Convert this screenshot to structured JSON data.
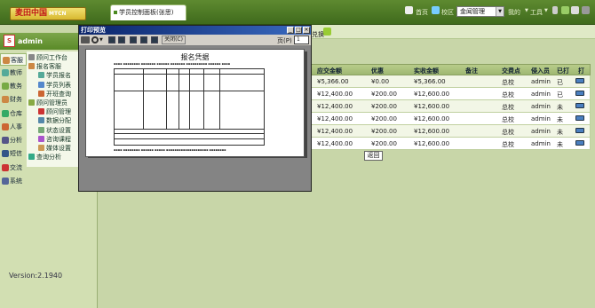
{
  "header": {
    "logo_text": "麦田中国",
    "logo_sub": "MTCN",
    "tab_title": "学员控制面板(张思)",
    "links": [
      "首页",
      "校区"
    ],
    "campus_selected": "金闻管理",
    "menu": [
      "我的",
      "工具"
    ]
  },
  "user": {
    "name": "admin",
    "avatar": "admin-avatar"
  },
  "sidebar": {
    "tabs": [
      {
        "label": "客服",
        "color": "#c84"
      },
      {
        "label": "教师",
        "color": "#5a9"
      },
      {
        "label": "教务",
        "color": "#7a4"
      },
      {
        "label": "财务",
        "color": "#c84"
      },
      {
        "label": "仓库",
        "color": "#3a6"
      },
      {
        "label": "人事",
        "color": "#c63"
      },
      {
        "label": "分析",
        "color": "#558"
      },
      {
        "label": "短信",
        "color": "#358"
      },
      {
        "label": "交流",
        "color": "#c33"
      },
      {
        "label": "系统",
        "color": "#569"
      }
    ],
    "tree": [
      {
        "label": "顾问工作台",
        "level": 0
      },
      {
        "label": "报名客服",
        "level": 0
      },
      {
        "label": "学员报名",
        "level": 1
      },
      {
        "label": "学员列表",
        "level": 1
      },
      {
        "label": "开班查询",
        "level": 1
      },
      {
        "label": "顾问管理员",
        "level": 0
      },
      {
        "label": "顾问管理",
        "level": 1
      },
      {
        "label": "数据分配",
        "level": 1
      },
      {
        "label": "状态设置",
        "level": 1
      },
      {
        "label": "咨询课程",
        "level": 1
      },
      {
        "label": "媒体设置",
        "level": 1
      },
      {
        "label": "查询分析",
        "level": 0
      }
    ],
    "version": "Version:2.1940"
  },
  "content": {
    "toolbar_label": "兑换",
    "table": {
      "columns": [
        "应交金额",
        "优惠",
        "实收金额",
        "备注",
        "交费点",
        "侵入员",
        "已打",
        "打印"
      ],
      "rows": [
        {
          "due": "¥5,366.00",
          "discount": "¥0.00",
          "paid": "¥5,366.00",
          "note": "",
          "point": "总校",
          "staff": "admin",
          "printed": "已"
        },
        {
          "due": "¥12,400.00",
          "discount": "¥200.00",
          "paid": "¥12,600.00",
          "note": "",
          "point": "总校",
          "staff": "admin",
          "printed": "已"
        },
        {
          "due": "¥12,400.00",
          "discount": "¥200.00",
          "paid": "¥12,600.00",
          "note": "",
          "point": "总校",
          "staff": "admin",
          "printed": "未"
        },
        {
          "due": "¥12,400.00",
          "discount": "¥200.00",
          "paid": "¥12,600.00",
          "note": "",
          "point": "总校",
          "staff": "admin",
          "printed": "未"
        },
        {
          "due": "¥12,400.00",
          "discount": "¥200.00",
          "paid": "¥12,600.00",
          "note": "",
          "point": "总校",
          "staff": "admin",
          "printed": "未"
        },
        {
          "due": "¥12,400.00",
          "discount": "¥200.00",
          "paid": "¥12,600.00",
          "note": "",
          "point": "总校",
          "staff": "admin",
          "printed": "未"
        }
      ]
    },
    "back_label": "返回"
  },
  "dialog": {
    "title": "打印预览",
    "close_label": "关闭(C)",
    "page_label": "页(P)",
    "page_value": "1",
    "preview_title": "报名凭据"
  }
}
